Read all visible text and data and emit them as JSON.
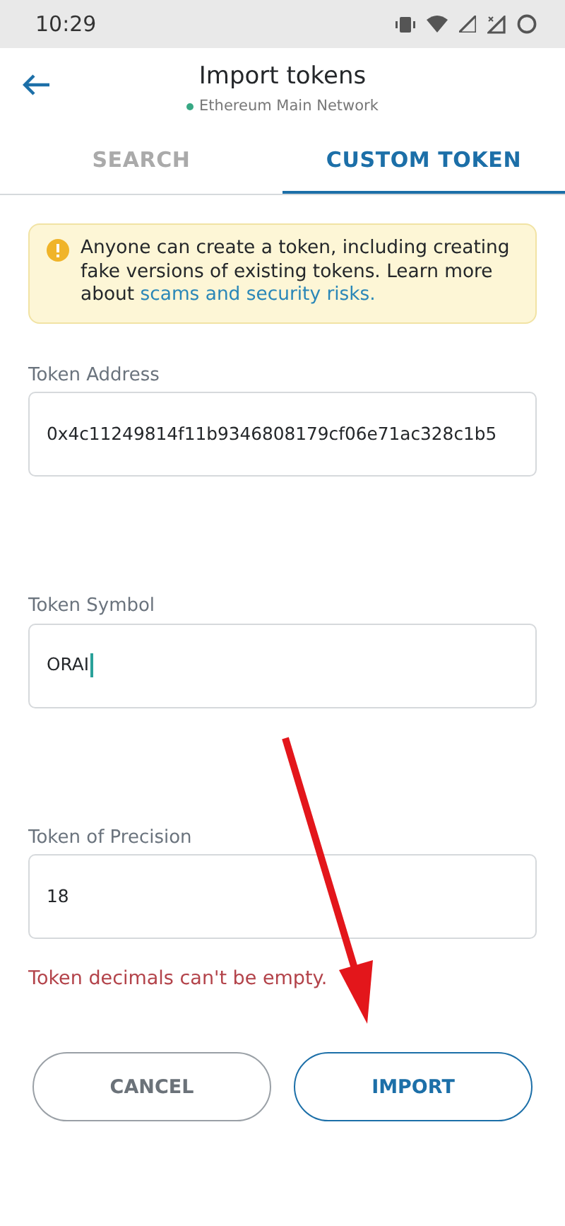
{
  "status_bar": {
    "time": "10:29"
  },
  "header": {
    "title": "Import tokens",
    "network": "Ethereum Main Network"
  },
  "tabs": [
    {
      "label": "SEARCH",
      "selected": false
    },
    {
      "label": "CUSTOM TOKEN",
      "selected": true
    }
  ],
  "warning": {
    "text": "Anyone can create a token, including creating fake versions of existing tokens. Learn more about ",
    "link": "scams and security risks."
  },
  "fields": [
    {
      "label": "Token Address",
      "value": "0x4c11249814f11b9346808179cf06e71ac328c1b5",
      "focused": false
    },
    {
      "label": "Token Symbol",
      "value": "ORAI",
      "focused": true
    },
    {
      "label": "Token of Precision",
      "value": "18",
      "focused": false
    }
  ],
  "error": "Token decimals can't be empty.",
  "buttons": [
    {
      "label": "CANCEL",
      "kind": "secondary"
    },
    {
      "label": "IMPORT",
      "kind": "primary"
    }
  ]
}
